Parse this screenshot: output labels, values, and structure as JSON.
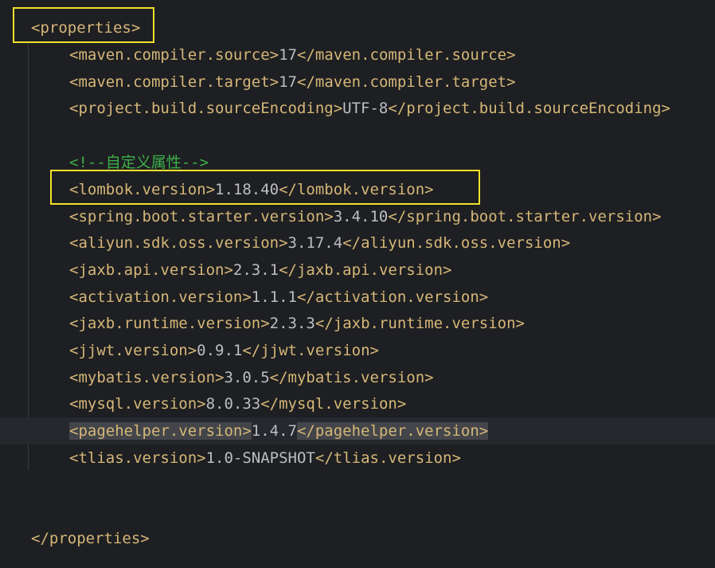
{
  "editor": {
    "lines": {
      "properties_open": {
        "tag": "<properties>"
      },
      "compiler_source": {
        "open": "<maven.compiler.source>",
        "value": "17",
        "close": "</maven.compiler.source>"
      },
      "compiler_target": {
        "open": "<maven.compiler.target>",
        "value": "17",
        "close": "</maven.compiler.target>"
      },
      "source_encoding": {
        "open": "<project.build.sourceEncoding>",
        "value": "UTF-8",
        "close": "</project.build.sourceEncoding>"
      },
      "custom_comment": {
        "text": "<!--自定义属性-->"
      },
      "lombok": {
        "open": "<lombok.version>",
        "value": "1.18.40",
        "close": "</lombok.version>"
      },
      "spring_boot_starter": {
        "open": "<spring.boot.starter.version>",
        "value": "3.4.10",
        "close": "</spring.boot.starter.version>"
      },
      "aliyun_sdk_oss": {
        "open": "<aliyun.sdk.oss.version>",
        "value": "3.17.4",
        "close": "</aliyun.sdk.oss.version>"
      },
      "jaxb_api": {
        "open": "<jaxb.api.version>",
        "value": "2.3.1",
        "close": "</jaxb.api.version>"
      },
      "activation": {
        "open": "<activation.version>",
        "value": "1.1.1",
        "close": "</activation.version>"
      },
      "jaxb_runtime": {
        "open": "<jaxb.runtime.version>",
        "value": "2.3.3",
        "close": "</jaxb.runtime.version>"
      },
      "jjwt": {
        "open": "<jjwt.version>",
        "value": "0.9.1",
        "close": "</jjwt.version>"
      },
      "mybatis": {
        "open": "<mybatis.version>",
        "value": "3.0.5",
        "close": "</mybatis.version>"
      },
      "mysql": {
        "open": "<mysql.version>",
        "value": "8.0.33",
        "close": "</mysql.version>"
      },
      "pagehelper": {
        "open": "<pagehelper.version>",
        "value": "1.4.7",
        "close": "</pagehelper.version>"
      },
      "tlias": {
        "open": "<tlias.version>",
        "value": "1.0-SNAPSHOT",
        "close": "</tlias.version>"
      },
      "properties_close": {
        "tag": "</properties>"
      }
    },
    "colors": {
      "background": "#1e1f22",
      "current_line": "#26282e",
      "tag": "#d5b778",
      "text": "#bcbec4",
      "comment": "#3cb04a",
      "highlight_box": "#f3e12a",
      "tag_match": "#43454a"
    }
  }
}
